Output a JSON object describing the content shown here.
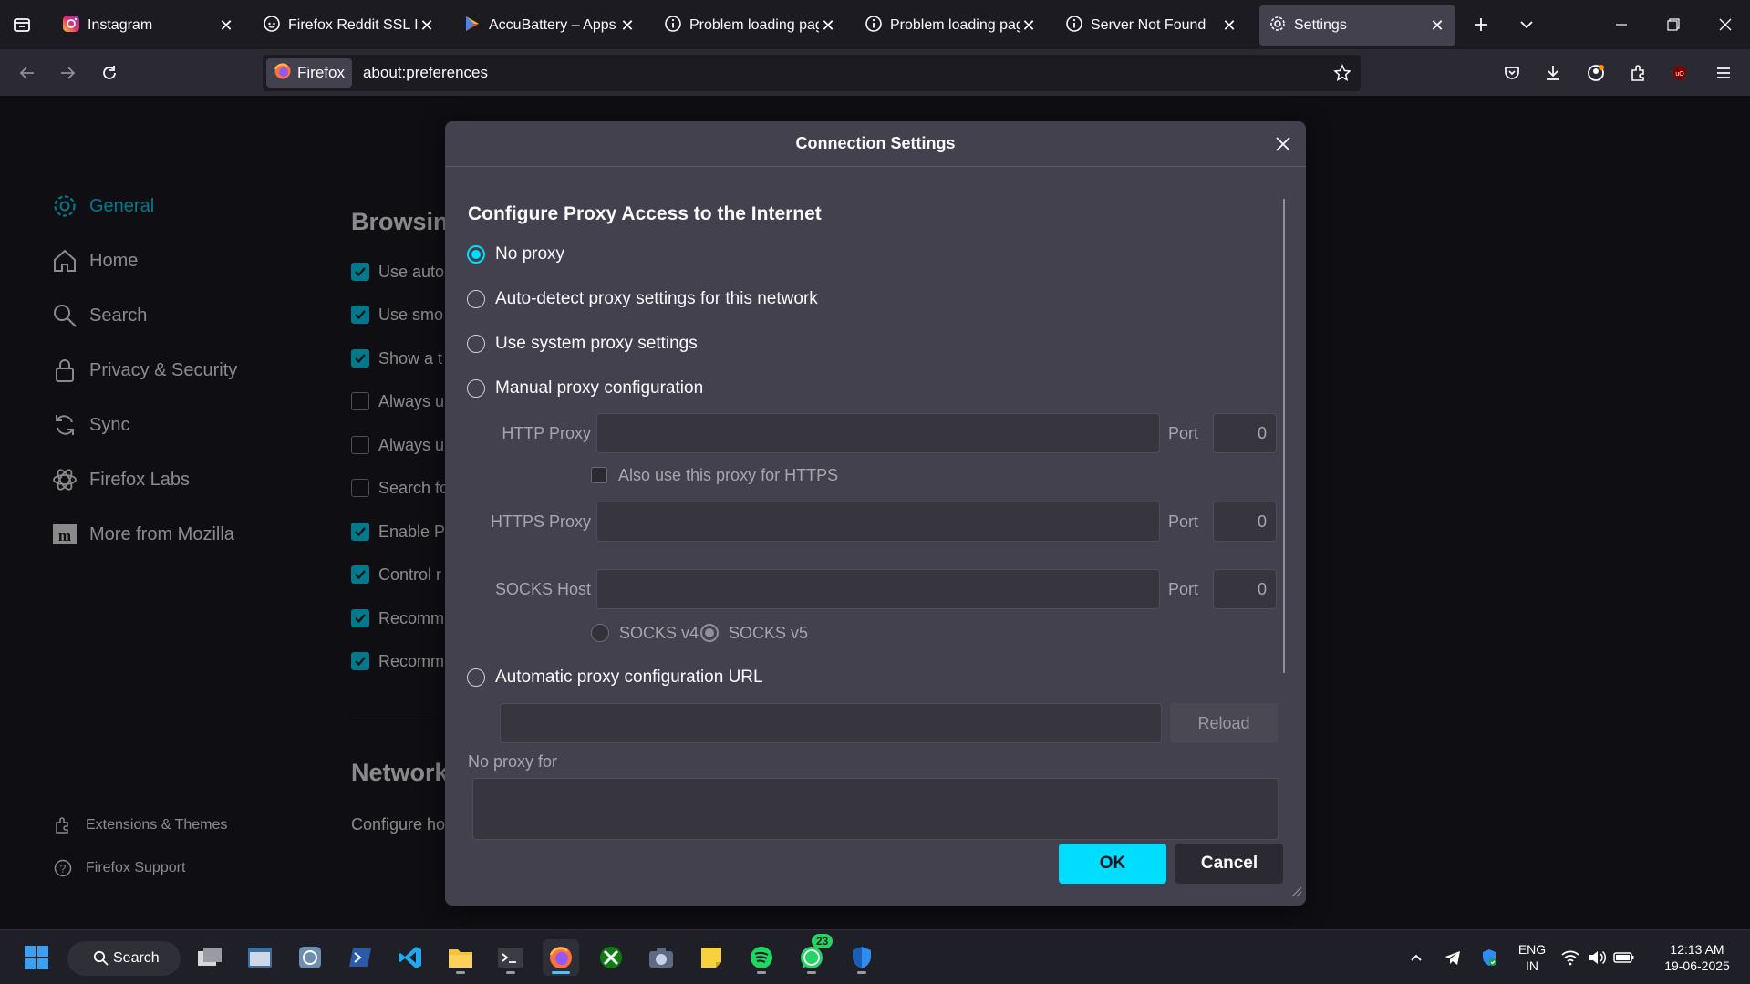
{
  "tabs": [
    {
      "title": "Instagram",
      "icon": "instagram-icon"
    },
    {
      "title": "Firefox Reddit SSL Issu",
      "icon": "reddit-icon"
    },
    {
      "title": "AccuBattery – Apps on",
      "icon": "play-store-icon"
    },
    {
      "title": "Problem loading page",
      "icon": "info-icon"
    },
    {
      "title": "Problem loading page",
      "icon": "info-icon"
    },
    {
      "title": "Server Not Found",
      "icon": "info-icon"
    },
    {
      "title": "Settings",
      "icon": "gear-icon"
    }
  ],
  "urlbar": {
    "identity_label": "Firefox",
    "url": "about:preferences"
  },
  "sidebar": {
    "categories": [
      {
        "label": "General",
        "icon": "gear-icon",
        "active": true
      },
      {
        "label": "Home",
        "icon": "home-icon"
      },
      {
        "label": "Search",
        "icon": "search-icon"
      },
      {
        "label": "Privacy & Security",
        "icon": "lock-icon"
      },
      {
        "label": "Sync",
        "icon": "sync-icon"
      },
      {
        "label": "Firefox Labs",
        "icon": "labs-icon"
      },
      {
        "label": "More from Mozilla",
        "icon": "mozilla-icon"
      }
    ],
    "footer": {
      "extensions": "Extensions & Themes",
      "support": "Firefox Support"
    }
  },
  "background": {
    "browsing_heading": "Browsing",
    "rows": [
      {
        "label": "Use auto",
        "checked": true
      },
      {
        "label": "Use smo",
        "checked": true
      },
      {
        "label": "Show a t",
        "checked": true
      },
      {
        "label": "Always u",
        "checked": false
      },
      {
        "label": "Always u",
        "checked": false
      },
      {
        "label": "Search fo",
        "checked": false
      },
      {
        "label": "Enable Pi",
        "checked": true
      },
      {
        "label": "Control r",
        "checked": true
      },
      {
        "label": "Recomm",
        "checked": true
      },
      {
        "label": "Recomm",
        "checked": true
      }
    ],
    "network_heading": "Network",
    "network_desc": "Configure ho"
  },
  "dialog": {
    "title": "Connection Settings",
    "heading": "Configure Proxy Access to the Internet",
    "options": {
      "no_proxy": "No proxy",
      "auto_detect": "Auto-detect proxy settings for this network",
      "system": "Use system proxy settings",
      "manual": "Manual proxy configuration",
      "auto_url": "Automatic proxy configuration URL"
    },
    "http_proxy_label": "HTTP Proxy",
    "https_proxy_label": "HTTPS Proxy",
    "socks_host_label": "SOCKS Host",
    "port_label": "Port",
    "http_port": "0",
    "https_port": "0",
    "socks_port": "0",
    "also_https_label": "Also use this proxy for HTTPS",
    "socks_v4": "SOCKS v4",
    "socks_v5": "SOCKS v5",
    "reload_label": "Reload",
    "no_proxy_for_label": "No proxy for",
    "ok_label": "OK",
    "cancel_label": "Cancel"
  },
  "taskbar": {
    "search_label": "Search",
    "whatsapp_badge": "23",
    "lang_top": "ENG",
    "lang_bottom": "IN",
    "time": "12:13 AM",
    "date": "19-06-2025"
  },
  "colors": {
    "accent": "#00ddff",
    "dialog_bg": "#42414d",
    "page_bg": "#1c1b22"
  }
}
